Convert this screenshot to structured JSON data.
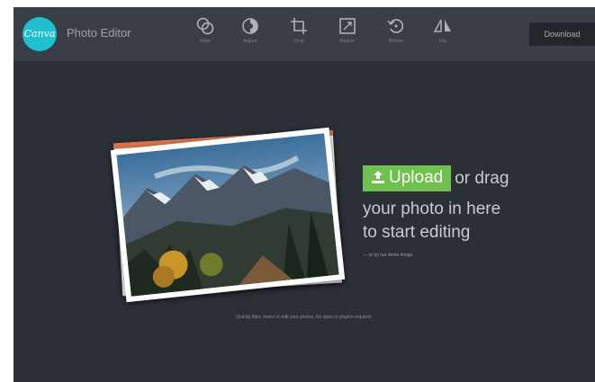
{
  "app": {
    "logo_text": "Canva",
    "title": "Photo Editor"
  },
  "toolbar": {
    "tools": [
      {
        "label": "Filter",
        "icon": "filter-icon"
      },
      {
        "label": "Adjust",
        "icon": "adjust-icon"
      },
      {
        "label": "Crop",
        "icon": "crop-icon"
      },
      {
        "label": "Resize",
        "icon": "resize-icon"
      },
      {
        "label": "Rotate",
        "icon": "rotate-icon"
      },
      {
        "label": "Flip",
        "icon": "flip-icon"
      }
    ],
    "download_label": "Download"
  },
  "upload": {
    "button_label": "Upload",
    "drag_text": "or drag",
    "line2": "your photo in here",
    "line3": "to start editing",
    "demo_link": "— or try our demo image"
  },
  "footer": {
    "text": "Quickly filter, resize or edit your photos. No apps or plugins required."
  },
  "colors": {
    "background": "#2b2f36",
    "topbar": "#3a3e46",
    "brand": "#1fc1cf",
    "accent": "#6fc04e"
  }
}
